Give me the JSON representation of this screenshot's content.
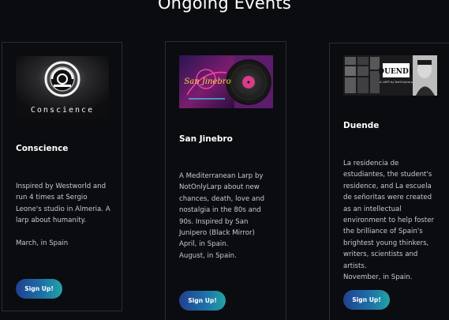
{
  "section": {
    "title": "Ongoing Events"
  },
  "events": [
    {
      "title": "Conscience",
      "image_text": "Conscience",
      "description": "Inspired by Westworld and run 4 times at Sergio Leone's studio in Almeria. A larp about humanity.",
      "date_location": "March, in Spain",
      "signup_label": "Sign Up!"
    },
    {
      "title": "San Jinebro",
      "image_text": "San Jinebro",
      "description": "A Mediterranean Larp by NotOnlyLarp about new chances, death, love and nostalgia in the 80s and 90s. Inspired by San Junipero (Black Mirror)",
      "date_location_1": "April, in Spain.",
      "date_location_2": "August, in Spain.",
      "signup_label": "Sign Up!"
    },
    {
      "title": "Duende",
      "image_text": "DUENDE",
      "image_subtext": "A LARP by NotOnlyLarp",
      "description": "La residencia de estudiantes, the student's residence, and La escuela de señoritas were created as an intellectual environment to help foster the brilliance of Spain's brightest young thinkers, writers, scientists and artists.",
      "date_location": "November, in Spain.",
      "signup_label": "Sign Up!"
    }
  ],
  "colors": {
    "background": "#0b0c10",
    "card_border": "#2b2d36",
    "button_gradient_start": "#21408f",
    "button_gradient_end": "#22a3a5"
  }
}
